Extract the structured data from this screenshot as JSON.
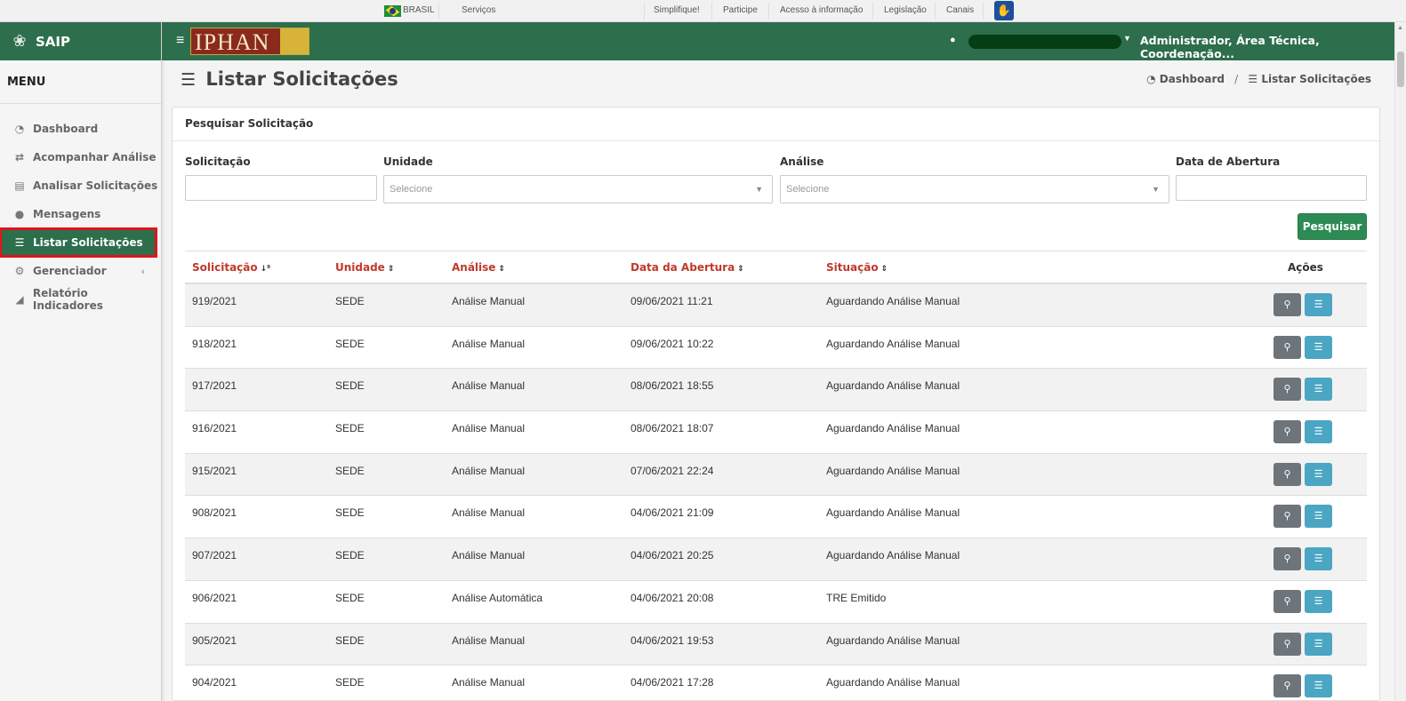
{
  "gov_bar": {
    "country": "BRASIL",
    "links": [
      "Serviços",
      "Simplifique!",
      "Participe",
      "Acesso à informação",
      "Legislação",
      "Canais"
    ]
  },
  "app": {
    "name": "SAIP",
    "logo_text": "IPHAN"
  },
  "header": {
    "user_role": "Administrador, Área Técnica, Coordenação..."
  },
  "sidebar": {
    "menu_title": "MENU",
    "items": [
      {
        "label": "Dashboard",
        "icon": "dashboard-icon"
      },
      {
        "label": "Acompanhar Análise",
        "icon": "exchange-icon"
      },
      {
        "label": "Analisar Solicitações",
        "icon": "book-icon"
      },
      {
        "label": "Mensagens",
        "icon": "comments-icon"
      },
      {
        "label": "Listar Solicitações",
        "icon": "list-icon",
        "active": true
      },
      {
        "label": "Gerenciador",
        "icon": "gears-icon"
      },
      {
        "label": "Relatório Indicadores",
        "icon": "area-chart-icon"
      }
    ]
  },
  "page": {
    "title": "Listar Solicitações",
    "breadcrumb": [
      "Dashboard",
      "Listar Solicitações"
    ]
  },
  "search": {
    "panel_title": "Pesquisar Solicitação",
    "fields": {
      "solicitacao": {
        "label": "Solicitação",
        "value": ""
      },
      "unidade": {
        "label": "Unidade",
        "placeholder": "Selecione"
      },
      "analise": {
        "label": "Análise",
        "placeholder": "Selecione"
      },
      "data_abertura": {
        "label": "Data de Abertura",
        "value": ""
      }
    },
    "button": "Pesquisar"
  },
  "table": {
    "columns": [
      "Solicitação",
      "Unidade",
      "Análise",
      "Data da Abertura",
      "Situação",
      "Ações"
    ],
    "rows": [
      [
        "919/2021",
        "SEDE",
        "Análise Manual",
        "09/06/2021 11:21",
        "Aguardando Análise Manual"
      ],
      [
        "918/2021",
        "SEDE",
        "Análise Manual",
        "09/06/2021 10:22",
        "Aguardando Análise Manual"
      ],
      [
        "917/2021",
        "SEDE",
        "Análise Manual",
        "08/06/2021 18:55",
        "Aguardando Análise Manual"
      ],
      [
        "916/2021",
        "SEDE",
        "Análise Manual",
        "08/06/2021 18:07",
        "Aguardando Análise Manual"
      ],
      [
        "915/2021",
        "SEDE",
        "Análise Manual",
        "07/06/2021 22:24",
        "Aguardando Análise Manual"
      ],
      [
        "908/2021",
        "SEDE",
        "Análise Manual",
        "04/06/2021 21:09",
        "Aguardando Análise Manual"
      ],
      [
        "907/2021",
        "SEDE",
        "Análise Manual",
        "04/06/2021 20:25",
        "Aguardando Análise Manual"
      ],
      [
        "906/2021",
        "SEDE",
        "Análise Automática",
        "04/06/2021 20:08",
        "TRE Emitido"
      ],
      [
        "905/2021",
        "SEDE",
        "Análise Manual",
        "04/06/2021 19:53",
        "Aguardando Análise Manual"
      ],
      [
        "904/2021",
        "SEDE",
        "Análise Manual",
        "04/06/2021 17:28",
        "Aguardando Análise Manual"
      ]
    ]
  },
  "colors": {
    "primary_green": "#2d6e4d",
    "sort_link_red": "#c0392b",
    "active_outline": "#e2141a"
  }
}
